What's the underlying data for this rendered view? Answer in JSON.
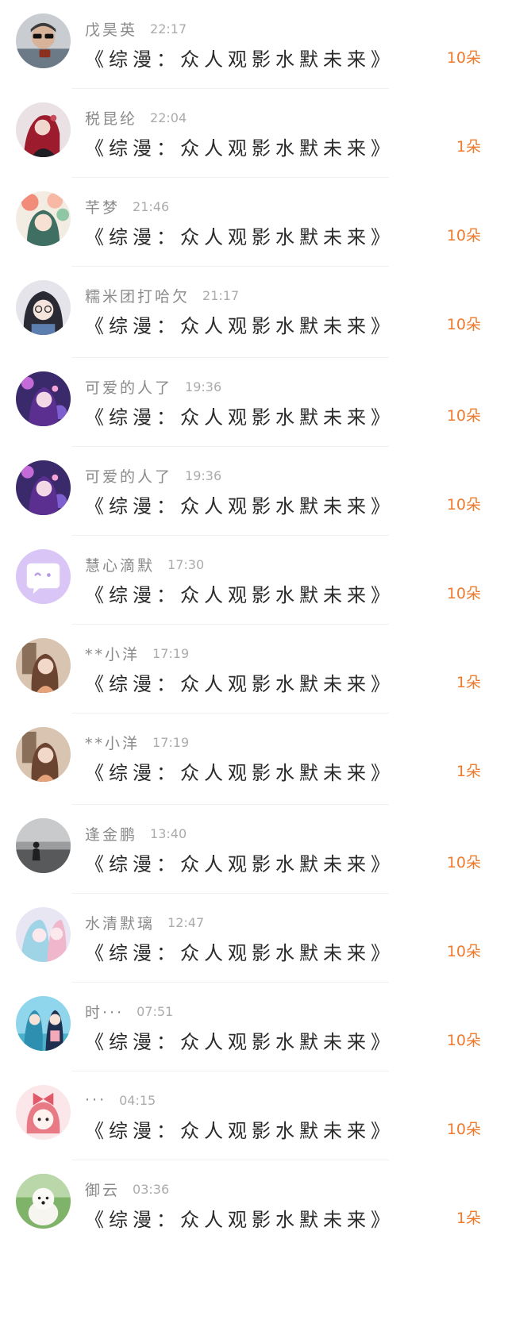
{
  "entries": [
    {
      "name": "戊昊英",
      "time": "22:17",
      "title": "《综漫：众人观影水默未来》",
      "gift": "10朵",
      "avatar": "avatar-man-sunglasses"
    },
    {
      "name": "税昆纶",
      "time": "22:04",
      "title": "《综漫：众人观影水默未来》",
      "gift": "1朵",
      "avatar": "avatar-red-hair-girl"
    },
    {
      "name": "芊梦",
      "time": "21:46",
      "title": "《综漫：众人观影水默未来》",
      "gift": "10朵",
      "avatar": "avatar-flower-girl"
    },
    {
      "name": "糯米团打哈欠",
      "time": "21:17",
      "title": "《综漫：众人观影水默未来》",
      "gift": "10朵",
      "avatar": "avatar-glasses-girl"
    },
    {
      "name": "可爱的人了",
      "time": "19:36",
      "title": "《综漫：众人观影水默未来》",
      "gift": "10朵",
      "avatar": "avatar-purple-anime"
    },
    {
      "name": "可爱的人了",
      "time": "19:36",
      "title": "《综漫：众人观影水默未来》",
      "gift": "10朵",
      "avatar": "avatar-purple-anime"
    },
    {
      "name": "慧心滴默",
      "time": "17:30",
      "title": "《综漫：众人观影水默未来》",
      "gift": "10朵",
      "avatar": "avatar-default-chat"
    },
    {
      "name": "**小洋",
      "time": "17:19",
      "title": "《综漫：众人观影水默未来》",
      "gift": "1朵",
      "avatar": "avatar-brown-hair-girl"
    },
    {
      "name": "**小洋",
      "time": "17:19",
      "title": "《综漫：众人观影水默未来》",
      "gift": "1朵",
      "avatar": "avatar-brown-hair-girl"
    },
    {
      "name": "逢金鹏",
      "time": "13:40",
      "title": "《综漫：众人观影水默未来》",
      "gift": "10朵",
      "avatar": "avatar-sea-silhouette"
    },
    {
      "name": "水清默璃",
      "time": "12:47",
      "title": "《综漫：众人观影水默未来》",
      "gift": "10朵",
      "avatar": "avatar-pastel-anime"
    },
    {
      "name": "时···",
      "time": "07:51",
      "title": "《综漫：众人观影水默未来》",
      "gift": "10朵",
      "avatar": "avatar-couple-beach"
    },
    {
      "name": "···",
      "time": "04:15",
      "title": "《综漫：众人观影水默未来》",
      "gift": "10朵",
      "avatar": "avatar-chibi-bow"
    },
    {
      "name": "御云",
      "time": "03:36",
      "title": "《综漫：众人观影水默未来》",
      "gift": "1朵",
      "avatar": "avatar-white-dog"
    }
  ],
  "colors": {
    "gift": "#ee7b2d",
    "name": "#8a8a8a",
    "time": "#ababab",
    "title": "#2b2b2b"
  }
}
